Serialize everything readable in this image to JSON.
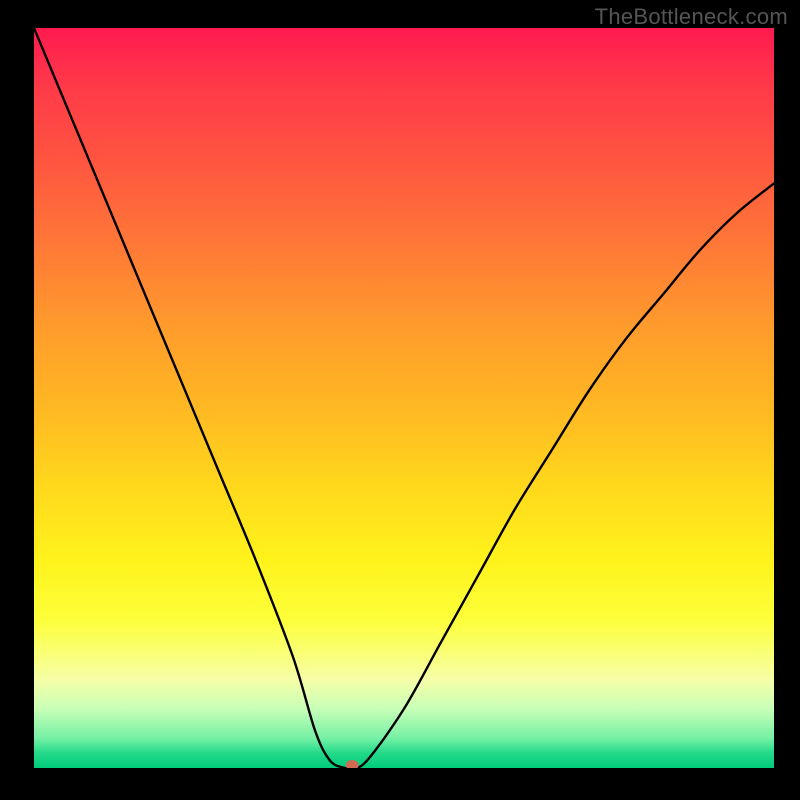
{
  "watermark": "TheBottleneck.com",
  "chart_data": {
    "type": "line",
    "title": "",
    "xlabel": "",
    "ylabel": "",
    "xlim": [
      0,
      100
    ],
    "ylim": [
      0,
      100
    ],
    "series": [
      {
        "name": "curve",
        "x": [
          0,
          5,
          10,
          15,
          20,
          25,
          30,
          35,
          38,
          40,
          42,
          43,
          45,
          50,
          55,
          60,
          65,
          70,
          75,
          80,
          85,
          90,
          95,
          100
        ],
        "values": [
          100,
          88,
          76,
          64,
          52,
          40,
          28,
          15,
          5,
          1,
          0,
          0,
          1,
          8,
          17,
          26,
          35,
          43,
          51,
          58,
          64,
          70,
          75,
          79
        ]
      }
    ],
    "marker": {
      "x": 43,
      "y": 0,
      "color": "#cf6a55"
    },
    "gradient_stops": [
      {
        "offset": 0,
        "color": "#ff1a4f"
      },
      {
        "offset": 50,
        "color": "#ffd400"
      },
      {
        "offset": 90,
        "color": "#f5ffb0"
      },
      {
        "offset": 100,
        "color": "#00cc7a"
      }
    ]
  }
}
